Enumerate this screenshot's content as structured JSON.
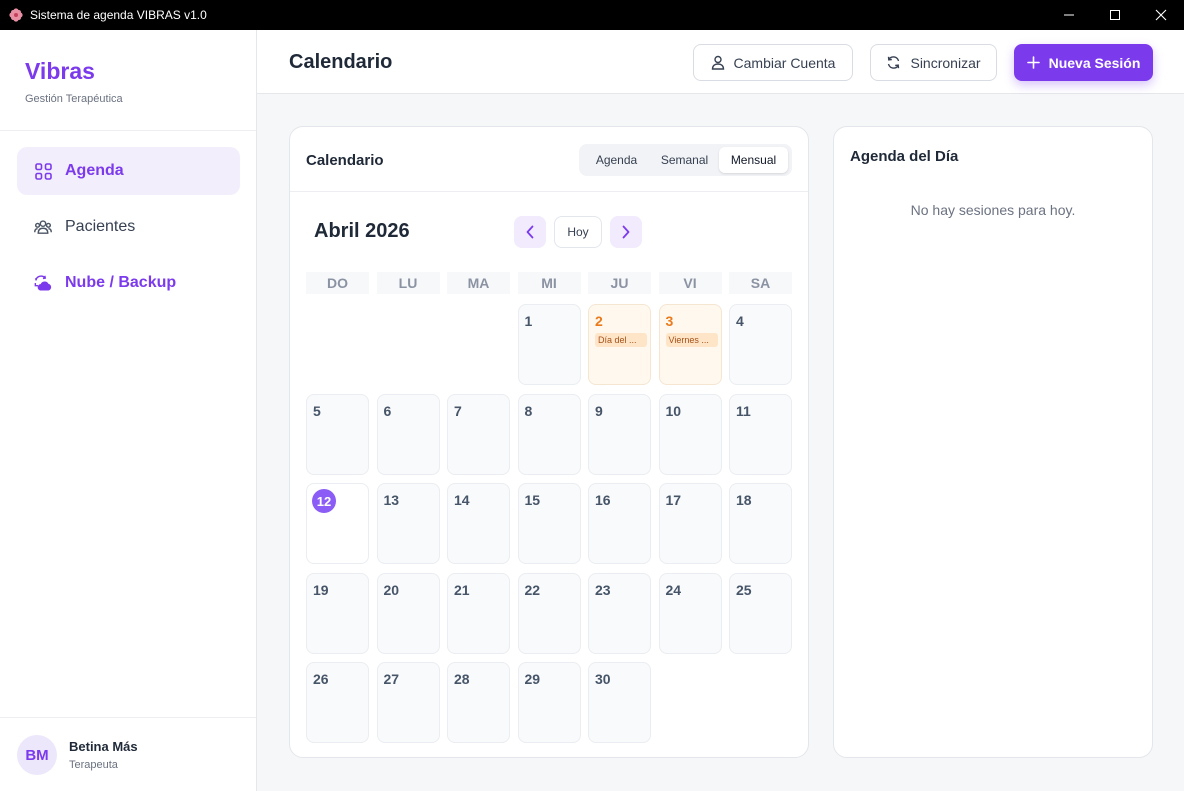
{
  "window": {
    "title": "Sistema de agenda VIBRAS v1.0"
  },
  "sidebar": {
    "brand": "Vibras",
    "subtitle": "Gestión Terapéutica",
    "items": [
      {
        "label": "Agenda",
        "icon": "grid-icon",
        "active": true
      },
      {
        "label": "Pacientes",
        "icon": "users-icon",
        "active": false
      },
      {
        "label": "Nube / Backup",
        "icon": "cloud-sync-icon",
        "active": false
      }
    ],
    "user": {
      "initials": "BM",
      "name": "Betina Más",
      "role": "Terapeuta"
    }
  },
  "header": {
    "title": "Calendario",
    "buttons": {
      "switch_account": "Cambiar Cuenta",
      "sync": "Sincronizar",
      "new_session": "Nueva Sesión"
    }
  },
  "calendar": {
    "card_title": "Calendario",
    "views": [
      "Agenda",
      "Semanal",
      "Mensual"
    ],
    "active_view": "Mensual",
    "month_label": "Abril 2026",
    "today_label": "Hoy",
    "weekdays": [
      "DO",
      "LU",
      "MA",
      "MI",
      "JU",
      "VI",
      "SA"
    ],
    "today": 12,
    "weeks": [
      [
        null,
        null,
        null,
        1,
        2,
        3,
        4
      ],
      [
        5,
        6,
        7,
        8,
        9,
        10,
        11
      ],
      [
        12,
        13,
        14,
        15,
        16,
        17,
        18
      ],
      [
        19,
        20,
        21,
        22,
        23,
        24,
        25
      ],
      [
        26,
        27,
        28,
        29,
        30,
        null,
        null
      ]
    ],
    "events": {
      "2": "Día del ...",
      "3": "Viernes ..."
    }
  },
  "day_agenda": {
    "title": "Agenda del Día",
    "empty_text": "No hay sesiones para hoy."
  },
  "colors": {
    "accent": "#7c3aed",
    "holiday_text": "#ea7a1c",
    "holiday_bg": "#fff8ef"
  }
}
